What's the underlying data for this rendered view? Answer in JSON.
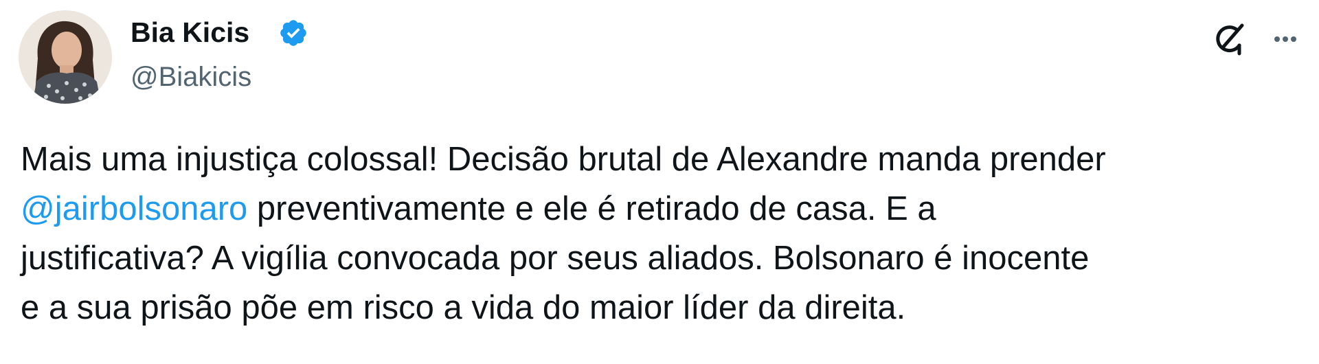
{
  "author": {
    "display_name": "Bia Kicis",
    "handle": "@Biakicis",
    "verified": true
  },
  "icons": {
    "verified": "verified-badge-icon",
    "grok": "grok-icon",
    "more": "more-options-icon"
  },
  "tweet": {
    "line1": "Mais uma injustiça colossal! Decisão brutal de Alexandre manda prender",
    "mention": "@jairbolsonaro",
    "line2_rest": " preventivamente e ele é retirado de casa. E a",
    "line3": "justificativa? A vigília convocada por seus aliados. Bolsonaro é inocente",
    "line4": "e a sua prisão põe em risco a vida do maior líder da direita."
  },
  "colors": {
    "text": "#0f1419",
    "secondary": "#536471",
    "link": "#1d9bf0",
    "verified": "#1d9bf0",
    "background": "#ffffff"
  }
}
